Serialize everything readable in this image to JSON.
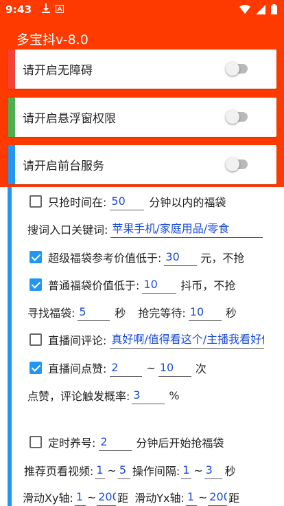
{
  "statusbar": {
    "time": "9:43"
  },
  "app": {
    "title": "多宝抖v-8.0"
  },
  "permissions": [
    {
      "label": "请开启无障碍",
      "accent": "#f44336",
      "enabled": false
    },
    {
      "label": "请开启悬浮窗权限",
      "accent": "#4caf50",
      "enabled": false
    },
    {
      "label": "请开启前台服务",
      "accent": "#2196f3",
      "enabled": false
    }
  ],
  "settings": {
    "time_limit": {
      "checked": false,
      "prefix": "只抢时间在:",
      "value": "50",
      "suffix": "分钟以内的福袋"
    },
    "keywords": {
      "label": "搜词入口关键词:",
      "value": "苹果手机/家庭用品/零食"
    },
    "super_bag": {
      "checked": true,
      "prefix": "超级福袋参考价值低于:",
      "value": "30",
      "suffix": "元，不抢"
    },
    "normal_bag": {
      "checked": true,
      "prefix": "普通福袋价值低于:",
      "value": "10",
      "suffix": "抖币，不抢"
    },
    "find": {
      "label": "寻找福袋:",
      "value": "5",
      "unit": "秒",
      "wait_label": "抢完等待:",
      "wait_value": "10",
      "wait_unit": "秒"
    },
    "comment": {
      "checked": false,
      "prefix": "直播间评论:",
      "value": "真好啊/值得看这个/主播我看好你"
    },
    "like": {
      "checked": true,
      "prefix": "直播间点赞:",
      "min": "2",
      "sep": "~",
      "max": "10",
      "unit": "次"
    },
    "rate": {
      "label": "点赞，评论触发概率:",
      "value": "3",
      "unit": "%"
    },
    "timer": {
      "checked": false,
      "prefix": "定时养号:",
      "value": "2",
      "suffix": "分钟后开始抢福袋"
    },
    "video": {
      "label": "推荐页看视频:",
      "min": "1",
      "sep": "~",
      "max": "5",
      "op_label": "操作间隔:",
      "op_min": "1",
      "op_sep": "~",
      "op_max": "3",
      "unit": "秒"
    },
    "swipe": {
      "x_label": "滑动Xy轴:",
      "x_min": "1",
      "x_sep": "~",
      "x_max": "200",
      "x_unit": "距",
      "y_label": "滑动Yx轴:",
      "y_min": "1",
      "y_sep": "~",
      "y_max": "200",
      "y_unit": "距"
    }
  },
  "colors": {
    "header": "#ff3a00",
    "accent_blue": "#2196f3",
    "input_text": "#1a4cd8"
  }
}
